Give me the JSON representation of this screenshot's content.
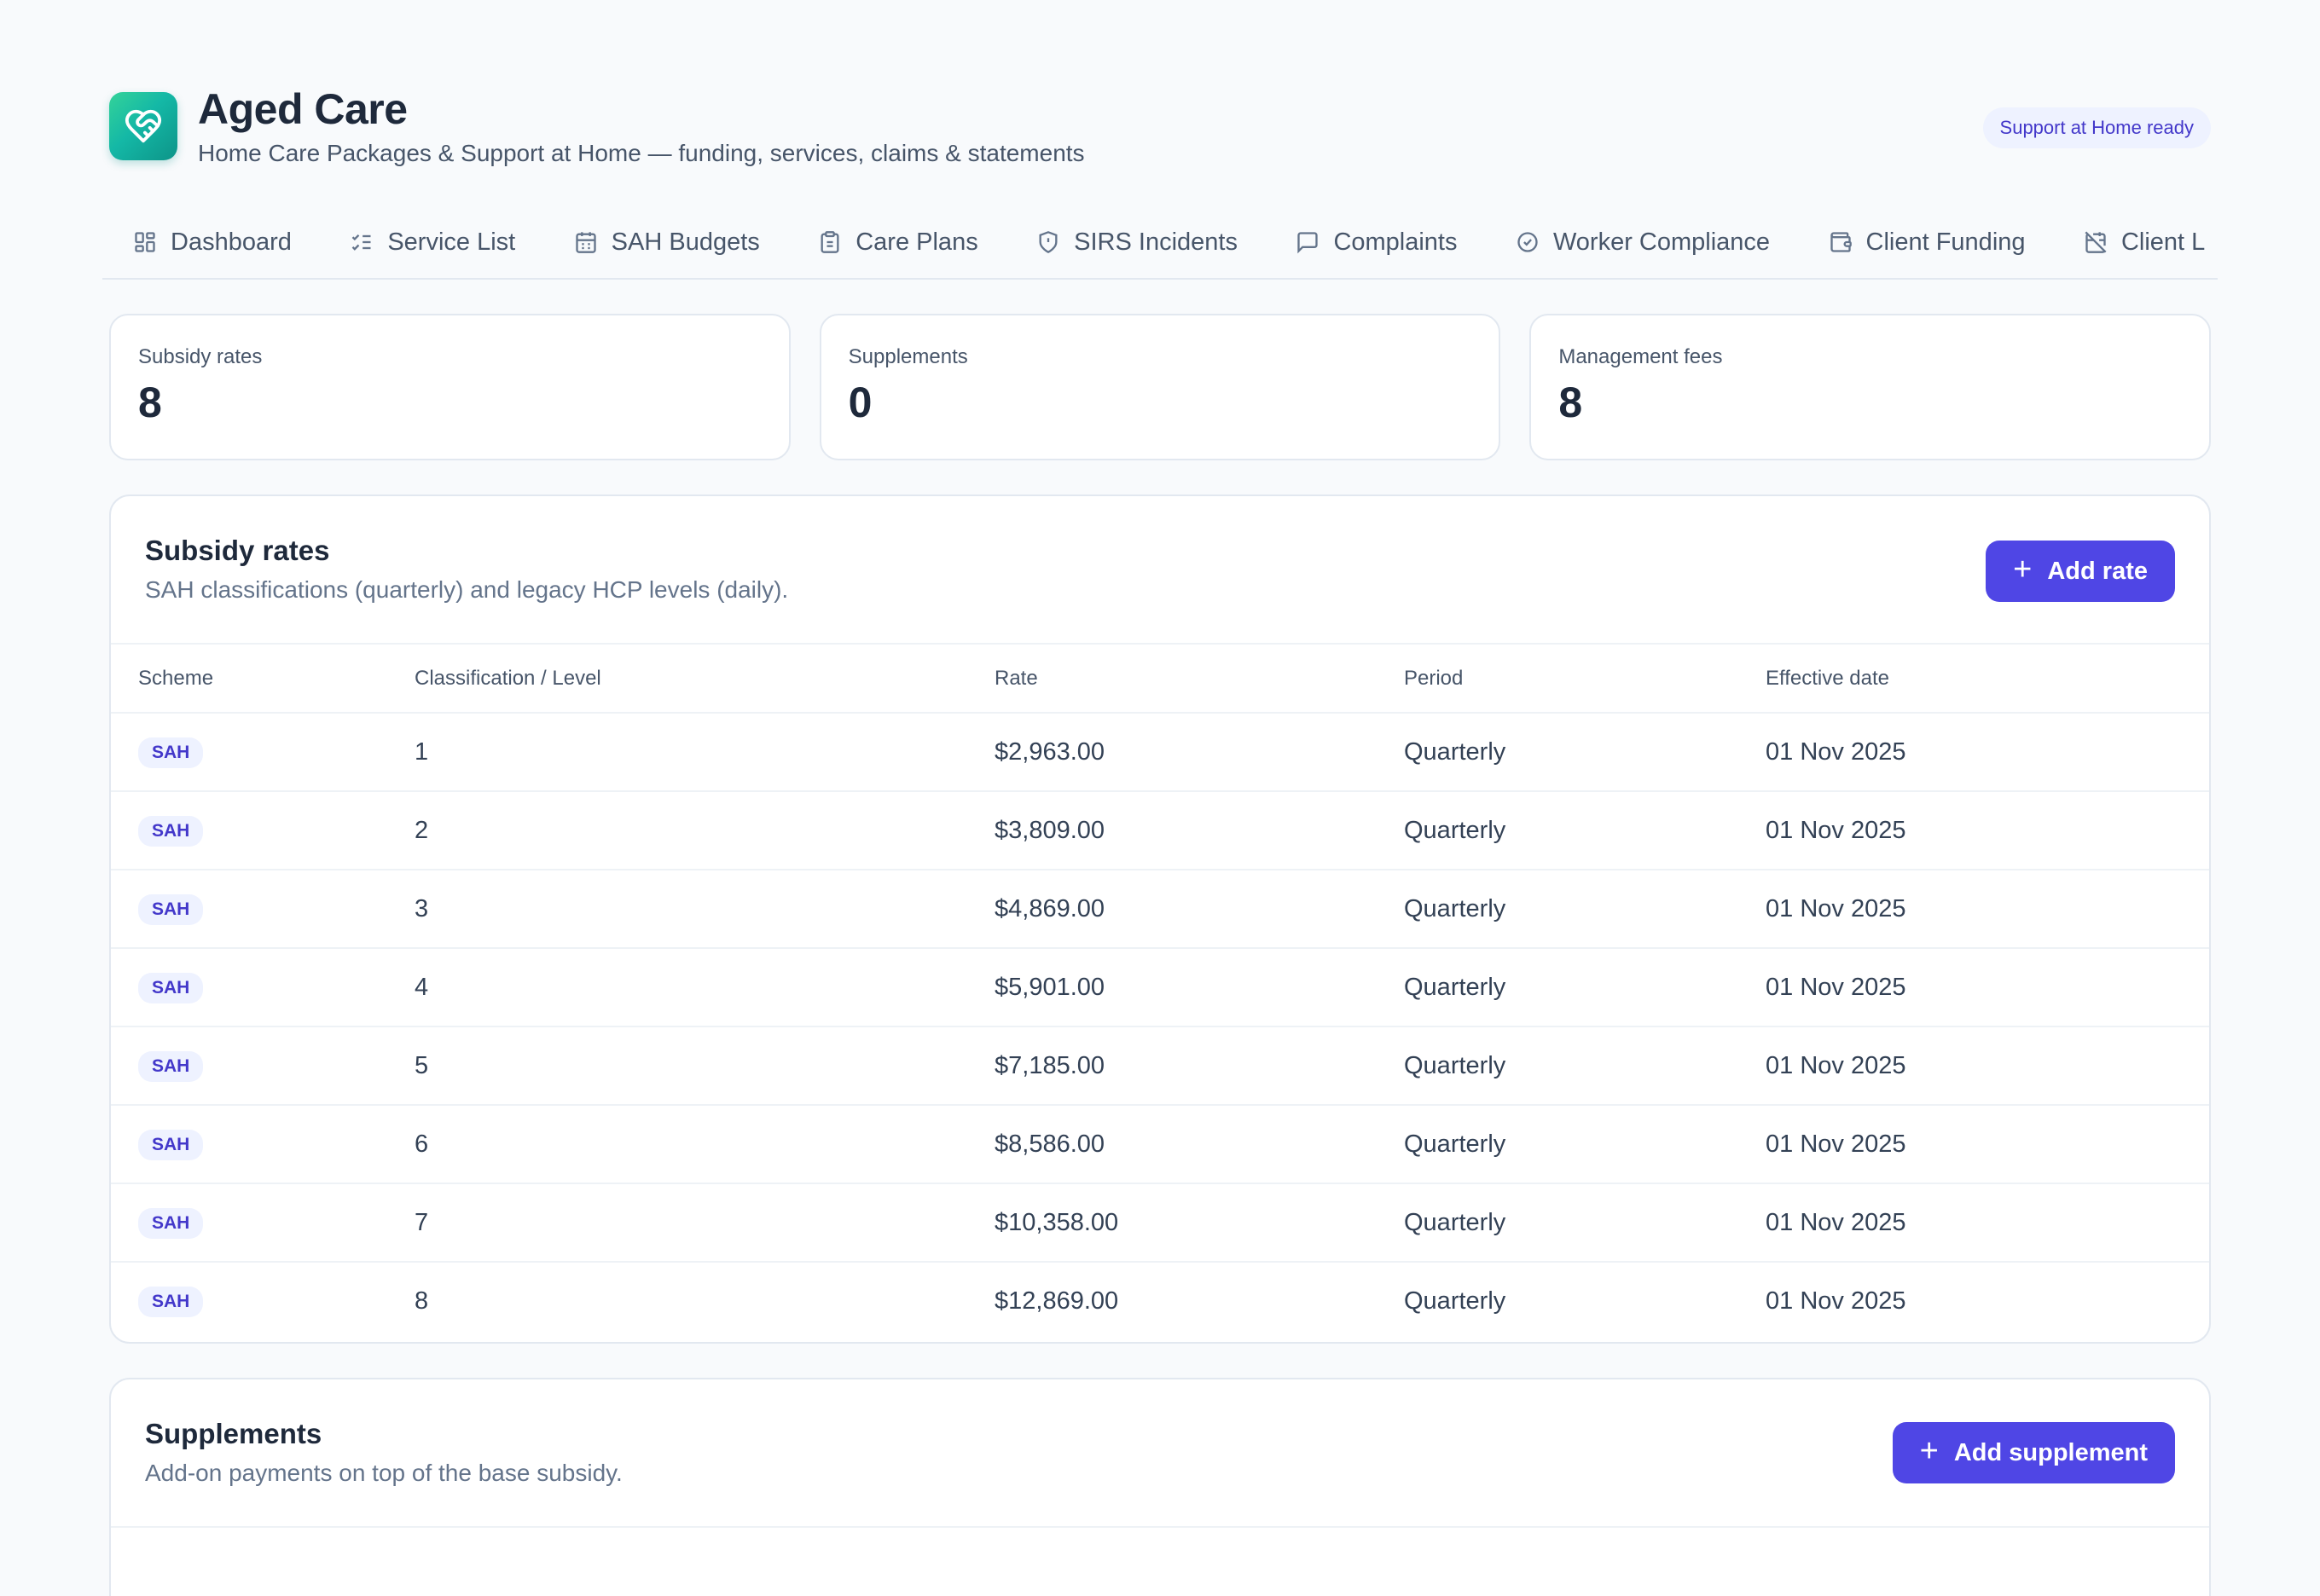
{
  "app": {
    "title": "Aged Care",
    "subtitle": "Home Care Packages & Support at Home — funding, services, claims & statements",
    "status_pill": "Support at Home ready",
    "logo_icon": "heart-handshake-icon",
    "brand_gradient": [
      "#34d399",
      "#0d9488"
    ]
  },
  "tabs": [
    {
      "label": "Dashboard",
      "icon": "grid-icon"
    },
    {
      "label": "Service List",
      "icon": "checklist-icon"
    },
    {
      "label": "SAH Budgets",
      "icon": "calendar-icon"
    },
    {
      "label": "Care Plans",
      "icon": "clipboard-icon"
    },
    {
      "label": "SIRS Incidents",
      "icon": "shield-alert-icon"
    },
    {
      "label": "Complaints",
      "icon": "message-square-icon"
    },
    {
      "label": "Worker Compliance",
      "icon": "check-circle-icon"
    },
    {
      "label": "Client Funding",
      "icon": "wallet-icon"
    },
    {
      "label": "Client L",
      "icon": "calendar-off-icon"
    }
  ],
  "stats": [
    {
      "label": "Subsidy rates",
      "value": "8"
    },
    {
      "label": "Supplements",
      "value": "0"
    },
    {
      "label": "Management fees",
      "value": "8"
    }
  ],
  "subsidy": {
    "title": "Subsidy rates",
    "description": "SAH classifications (quarterly) and legacy HCP levels (daily).",
    "add_label": "Add rate",
    "columns": [
      "Scheme",
      "Classification / Level",
      "Rate",
      "Period",
      "Effective date"
    ],
    "rows": [
      {
        "scheme": "SAH",
        "level": "1",
        "rate": "$2,963.00",
        "period": "Quarterly",
        "effective": "01 Nov 2025"
      },
      {
        "scheme": "SAH",
        "level": "2",
        "rate": "$3,809.00",
        "period": "Quarterly",
        "effective": "01 Nov 2025"
      },
      {
        "scheme": "SAH",
        "level": "3",
        "rate": "$4,869.00",
        "period": "Quarterly",
        "effective": "01 Nov 2025"
      },
      {
        "scheme": "SAH",
        "level": "4",
        "rate": "$5,901.00",
        "period": "Quarterly",
        "effective": "01 Nov 2025"
      },
      {
        "scheme": "SAH",
        "level": "5",
        "rate": "$7,185.00",
        "period": "Quarterly",
        "effective": "01 Nov 2025"
      },
      {
        "scheme": "SAH",
        "level": "6",
        "rate": "$8,586.00",
        "period": "Quarterly",
        "effective": "01 Nov 2025"
      },
      {
        "scheme": "SAH",
        "level": "7",
        "rate": "$10,358.00",
        "period": "Quarterly",
        "effective": "01 Nov 2025"
      },
      {
        "scheme": "SAH",
        "level": "8",
        "rate": "$12,869.00",
        "period": "Quarterly",
        "effective": "01 Nov 2025"
      }
    ]
  },
  "supplements": {
    "title": "Supplements",
    "description": "Add-on payments on top of the base subsidy.",
    "add_label": "Add supplement"
  },
  "colors": {
    "accent": "#4f46e5",
    "badge_bg": "#eef2ff",
    "badge_text": "#4338ca"
  }
}
